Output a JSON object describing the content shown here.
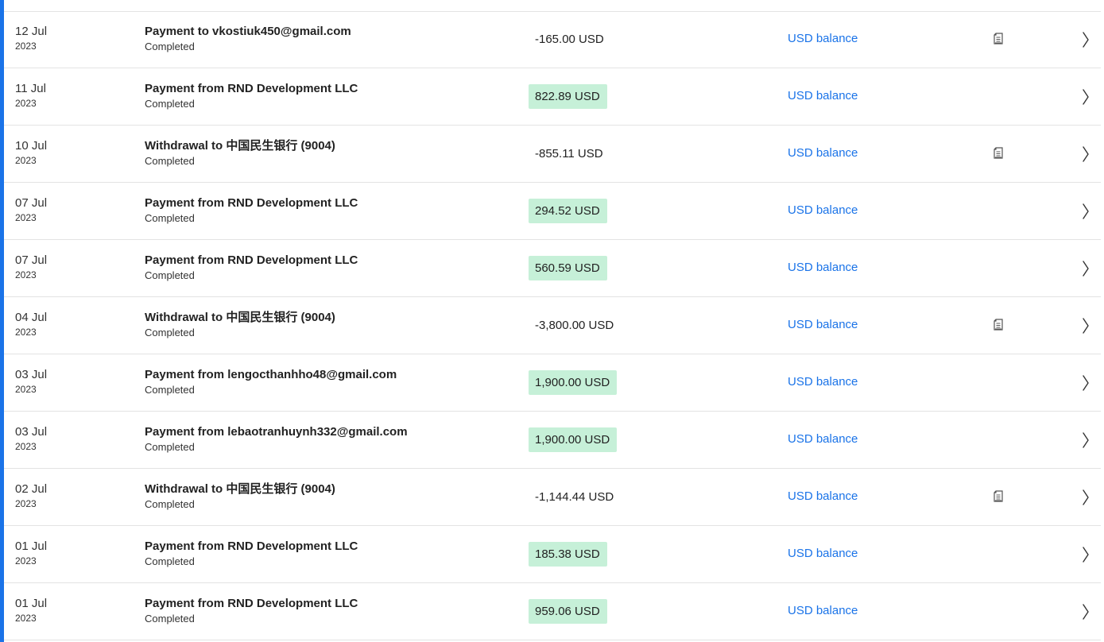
{
  "colors": {
    "accent": "#1a73e8",
    "credit_bg": "#c6f0d8",
    "link": "#1a73e8",
    "divider": "#e3e3e3"
  },
  "icons": {
    "document": "document-icon",
    "chevron": "chevron-right-icon"
  },
  "transactions": [
    {
      "day": "12 Jul",
      "year": "2023",
      "title": "Payment to vkostiuk450@gmail.com",
      "status": "Completed",
      "amount": "-165.00 USD",
      "credit": false,
      "balance": "USD balance",
      "doc": true
    },
    {
      "day": "11 Jul",
      "year": "2023",
      "title": "Payment from RND Development LLC",
      "status": "Completed",
      "amount": "822.89 USD",
      "credit": true,
      "balance": "USD balance",
      "doc": false
    },
    {
      "day": "10 Jul",
      "year": "2023",
      "title": "Withdrawal to 中国民生银行 (9004)",
      "status": "Completed",
      "amount": "-855.11 USD",
      "credit": false,
      "balance": "USD balance",
      "doc": true
    },
    {
      "day": "07 Jul",
      "year": "2023",
      "title": "Payment from RND Development LLC",
      "status": "Completed",
      "amount": "294.52 USD",
      "credit": true,
      "balance": "USD balance",
      "doc": false
    },
    {
      "day": "07 Jul",
      "year": "2023",
      "title": "Payment from RND Development LLC",
      "status": "Completed",
      "amount": "560.59 USD",
      "credit": true,
      "balance": "USD balance",
      "doc": false
    },
    {
      "day": "04 Jul",
      "year": "2023",
      "title": "Withdrawal to 中国民生银行 (9004)",
      "status": "Completed",
      "amount": "-3,800.00 USD",
      "credit": false,
      "balance": "USD balance",
      "doc": true
    },
    {
      "day": "03 Jul",
      "year": "2023",
      "title": "Payment from lengocthanhho48@gmail.com",
      "status": "Completed",
      "amount": "1,900.00 USD",
      "credit": true,
      "balance": "USD balance",
      "doc": false
    },
    {
      "day": "03 Jul",
      "year": "2023",
      "title": "Payment from lebaotranhuynh332@gmail.com",
      "status": "Completed",
      "amount": "1,900.00 USD",
      "credit": true,
      "balance": "USD balance",
      "doc": false
    },
    {
      "day": "02 Jul",
      "year": "2023",
      "title": "Withdrawal to 中国民生银行 (9004)",
      "status": "Completed",
      "amount": "-1,144.44 USD",
      "credit": false,
      "balance": "USD balance",
      "doc": true
    },
    {
      "day": "01 Jul",
      "year": "2023",
      "title": "Payment from RND Development LLC",
      "status": "Completed",
      "amount": "185.38 USD",
      "credit": true,
      "balance": "USD balance",
      "doc": false
    },
    {
      "day": "01 Jul",
      "year": "2023",
      "title": "Payment from RND Development LLC",
      "status": "Completed",
      "amount": "959.06 USD",
      "credit": true,
      "balance": "USD balance",
      "doc": false
    }
  ]
}
